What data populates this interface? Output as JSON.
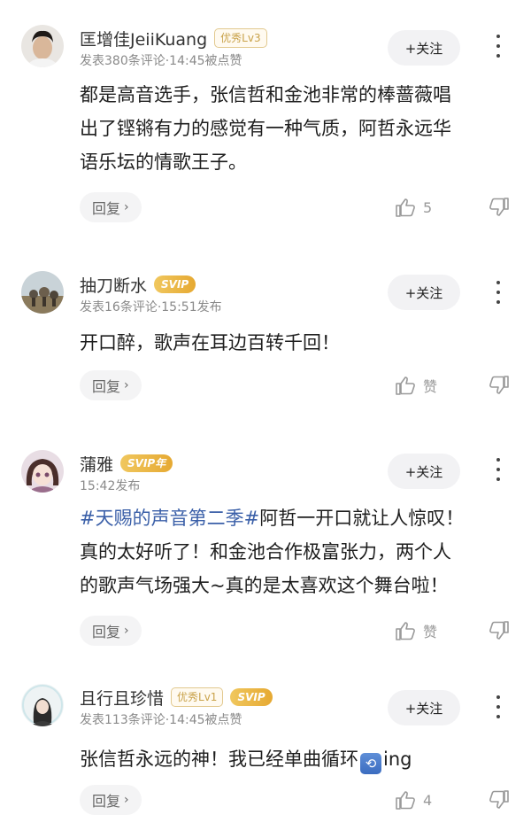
{
  "comments": [
    {
      "username": "匡增佳JeiiKuang",
      "badges": [
        "优秀Lv3"
      ],
      "meta": "发表380条评论·14:45被点赞",
      "follow_label": "+关注",
      "content_lines": [
        "都是高音选手，张信哲和金池非常的棒蔷薇唱",
        "出了铿锵有力的感觉有一种气质，阿哲永远华",
        "语乐坛的情歌王子。"
      ],
      "reply_label": "回复",
      "like_count": "5"
    },
    {
      "username": "抽刀断水",
      "badges": [
        "SVIP"
      ],
      "meta": "发表16条评论·15:51发布",
      "follow_label": "+关注",
      "content_lines": [
        "开口醉，歌声在耳边百转千回！"
      ],
      "reply_label": "回复",
      "like_count": "赞"
    },
    {
      "username": "蒲雅",
      "badges": [
        "SVIP年"
      ],
      "meta": "15:42发布",
      "follow_label": "+关注",
      "content_tag": "#天赐的声音第二季#",
      "content_lines": [
        "阿哲一开口就让人惊叹！",
        "真的太好听了！和金池合作极富张力，两个人",
        "的歌声气场强大~真的是太喜欢这个舞台啦！"
      ],
      "reply_label": "回复",
      "like_count": "赞"
    },
    {
      "username": "且行且珍惜",
      "badges": [
        "优秀Lv1",
        "SVIP"
      ],
      "meta": "发表113条评论·14:45被点赞",
      "follow_label": "+关注",
      "content_prefix": "张信哲永远的神！我已经单曲循环",
      "content_suffix": "ing",
      "reply_label": "回复",
      "like_count": "4"
    }
  ],
  "icons": {
    "thumb_up": "thumb-up-icon",
    "thumb_down": "thumb-down-icon",
    "more": "more-vertical-icon",
    "repeat": "repeat-icon"
  },
  "colors": {
    "tag_link": "#3a5fa8",
    "badge_gold": "#c9a24a",
    "svip_gold": "#e6a932"
  }
}
